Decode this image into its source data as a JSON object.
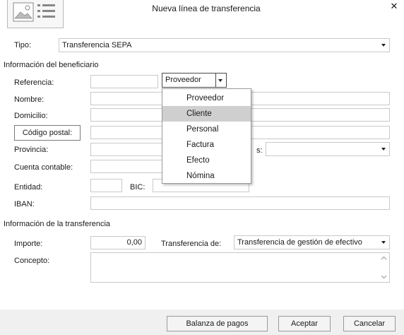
{
  "window": {
    "title": "Nueva línea de transferencia",
    "close_glyph": "✕",
    "icon": "document-card-icon"
  },
  "tipo": {
    "label": "Tipo:",
    "value": "Transferencia SEPA"
  },
  "beneficiario": {
    "section_title": "Información del beneficiario",
    "referencia_label": "Referencia:",
    "referencia_value": "",
    "tipo_beneficiario": "Proveedor",
    "nombre_label": "Nombre:",
    "domicilio_label": "Domicilio:",
    "codigo_postal_button": "Código postal:",
    "provincia_label": "Provincia:",
    "pais_label_partial": "s:",
    "cuenta_label": "Cuenta contable:",
    "entidad_label": "Entidad:",
    "bic_label": "BIC:",
    "iban_label": "IBAN:"
  },
  "dropdown": {
    "options": [
      "Proveedor",
      "Cliente",
      "Personal",
      "Factura",
      "Efecto",
      "Nómina"
    ],
    "highlighted": "Cliente"
  },
  "transferencia": {
    "section_title": "Información de la transferencia",
    "importe_label": "Importe:",
    "importe_value": "0,00",
    "transferencia_de_label": "Transferencia de:",
    "transferencia_de_value": "Transferencia de gestión de efectivo",
    "concepto_label": "Concepto:"
  },
  "buttons": {
    "balanza": "Balanza de pagos",
    "aceptar": "Aceptar",
    "cancelar": "Cancelar"
  },
  "colors": {
    "highlight": "#cfcfcf",
    "border": "#c9c9c9",
    "footer": "#f0f0f0"
  }
}
